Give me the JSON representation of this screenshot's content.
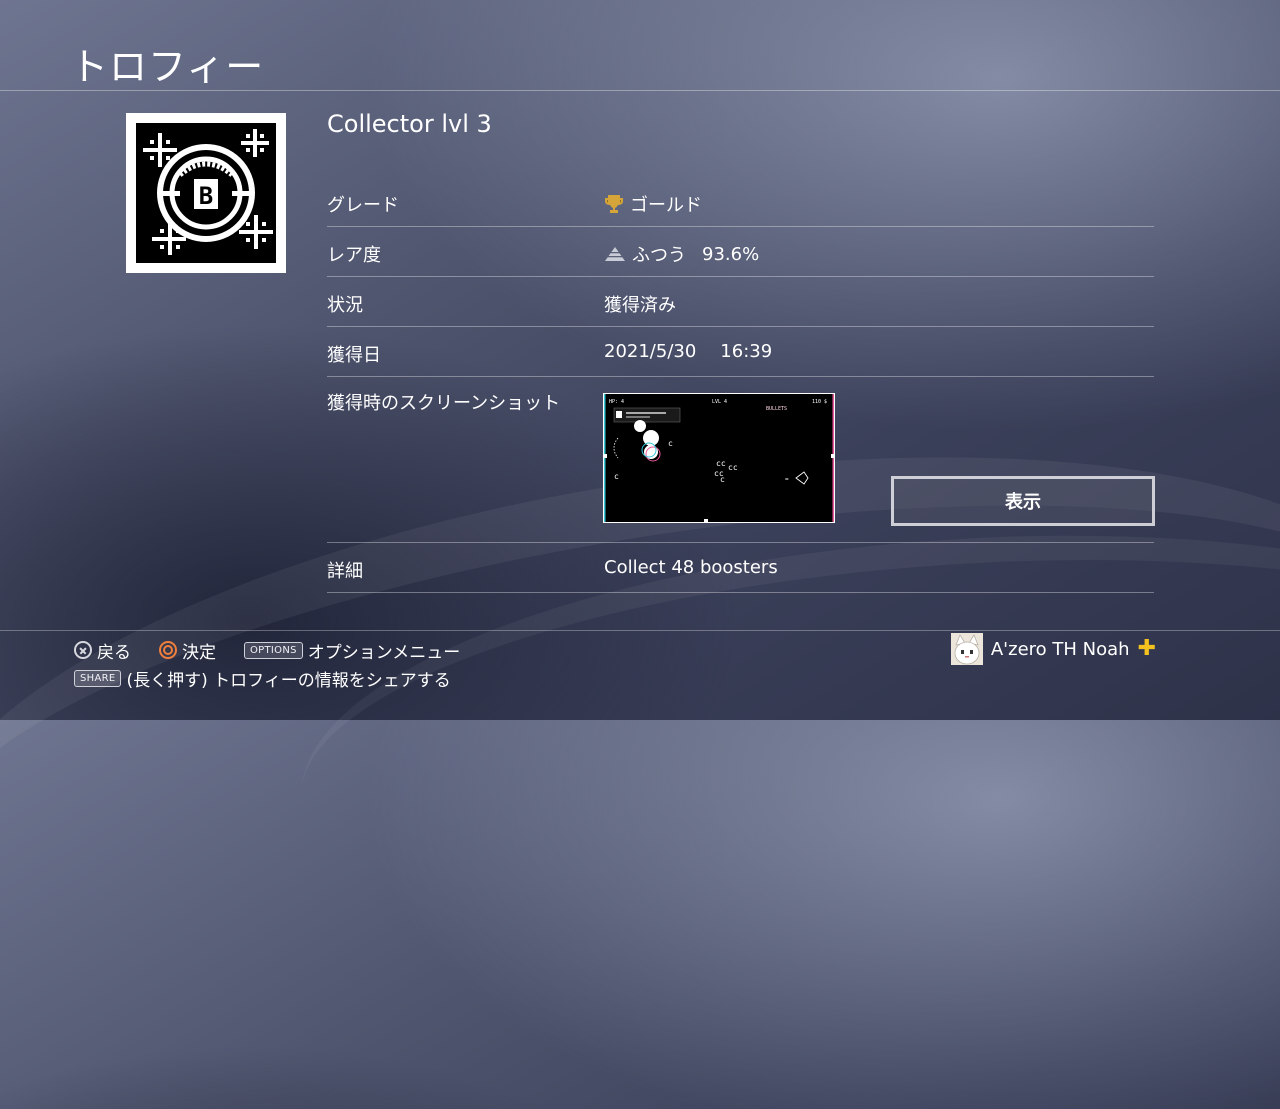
{
  "header": {
    "title": "トロフィー"
  },
  "trophy": {
    "name": "Collector lvl 3",
    "icon": "pixel-b-coin-trophy-icon"
  },
  "details": {
    "grade_label": "グレード",
    "grade_value": "ゴールド",
    "grade_icon": "gold-trophy-icon",
    "rarity_label": "レア度",
    "rarity_value": "ふつう",
    "rarity_percent": "93.6%",
    "rarity_icon": "rarity-pyramid-icon",
    "status_label": "状況",
    "status_value": "獲得済み",
    "date_label": "獲得日",
    "date_value": "2021/5/30",
    "time_value": "16:39",
    "screenshot_label": "獲得時のスクリーンショット",
    "show_button_label": "表示",
    "description_label": "詳細",
    "description_value": "Collect 48 boosters"
  },
  "screenshot_thumb": {
    "hp_text": "HP: 4",
    "level_text": "LVL 4",
    "money_text": "110 $",
    "bullets_text": "BULLETS"
  },
  "footer": {
    "back_label": "戻る",
    "confirm_label": "決定",
    "options_key": "OPTIONS",
    "options_label": "オプションメニュー",
    "share_key": "SHARE",
    "share_label": "(長く押す) トロフィーの情報をシェアする"
  },
  "user": {
    "name": "A'zero TH Noah",
    "plus_icon": "ps-plus-icon"
  },
  "colors": {
    "gold": "#d6a53a",
    "plus": "#f4c21e",
    "circle_button": "#f07e3c"
  }
}
